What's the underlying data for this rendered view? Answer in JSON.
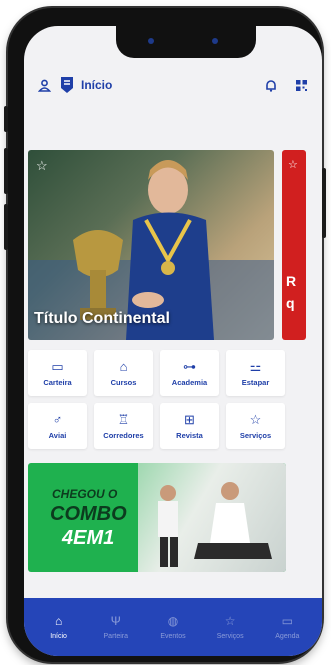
{
  "header": {
    "title": "Início"
  },
  "carousel": {
    "slides": [
      {
        "caption": "Título Continental"
      },
      {
        "caption": "R\nq"
      }
    ]
  },
  "shortcuts": [
    {
      "label": "Carteira",
      "icon": "id-card-icon",
      "glyph": "🪪"
    },
    {
      "label": "Cursos",
      "icon": "graduation-cap-icon",
      "glyph": "🎓"
    },
    {
      "label": "Academia",
      "icon": "dumbbell-icon",
      "glyph": "⚒"
    },
    {
      "label": "Estapar",
      "icon": "car-icon",
      "glyph": "🚗"
    },
    {
      "label": "Aviai",
      "icon": "runner-icon",
      "glyph": "🏃"
    },
    {
      "label": "Corredores",
      "icon": "trophy-icon",
      "glyph": "🏆"
    },
    {
      "label": "Revista",
      "icon": "book-icon",
      "glyph": "📖"
    },
    {
      "label": "Serviços",
      "icon": "star-icon",
      "glyph": "☆"
    }
  ],
  "banner": {
    "line1": "CHEGOU O",
    "line2": "COMBO",
    "line3": "4EM1"
  },
  "bottom_nav": [
    {
      "label": "Início",
      "icon": "home-icon",
      "active": true
    },
    {
      "label": "Parteira",
      "icon": "fork-icon",
      "active": false
    },
    {
      "label": "Eventos",
      "icon": "globe-icon",
      "active": false
    },
    {
      "label": "Serviços",
      "icon": "star-icon",
      "active": false
    },
    {
      "label": "Agenda",
      "icon": "calendar-icon",
      "active": false
    }
  ],
  "colors": {
    "accent": "#1f3fa8",
    "nav_bg": "#2545b8",
    "banner_green": "#1fb14f",
    "promo_red": "#d11f1f"
  }
}
